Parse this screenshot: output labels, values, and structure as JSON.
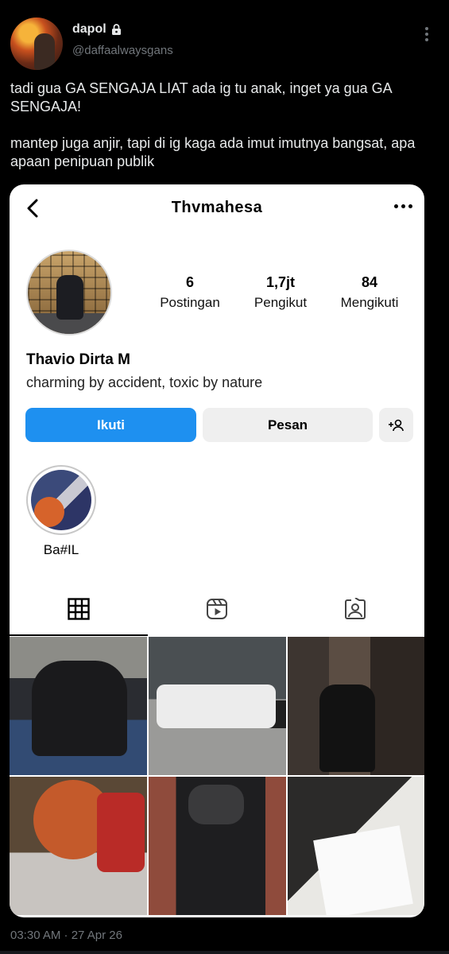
{
  "tweet": {
    "display_name": "dapol",
    "handle": "@daffaalwaysgans",
    "text_lines": [
      "tadi gua GA SENGAJA LIAT ada ig tu anak, inget ya gua GA SENGAJA!",
      "mantep juga anjir, tapi di ig kaga ada imut imutnya bangsat, apa apaan penipuan publik"
    ],
    "timestamp": "03:30 AM · 27 Apr 26"
  },
  "instagram": {
    "username": "Thvmahesa",
    "stats": [
      {
        "value": "6",
        "label": "Postingan"
      },
      {
        "value": "1,7jt",
        "label": "Pengikut"
      },
      {
        "value": "84",
        "label": "Mengikuti"
      }
    ],
    "full_name": "Thavio Dirta M",
    "bio": "charming by accident, toxic by nature",
    "buttons": {
      "follow": "Ikuti",
      "message": "Pesan"
    },
    "highlight": {
      "label": "Ba#IL"
    },
    "tabs": [
      "grid-icon",
      "reels-icon",
      "tagged-icon"
    ],
    "posts": 6
  },
  "colors": {
    "background": "#000000",
    "text": "#e7e9ea",
    "muted": "#71767b",
    "follow_button": "#1e90f0"
  }
}
